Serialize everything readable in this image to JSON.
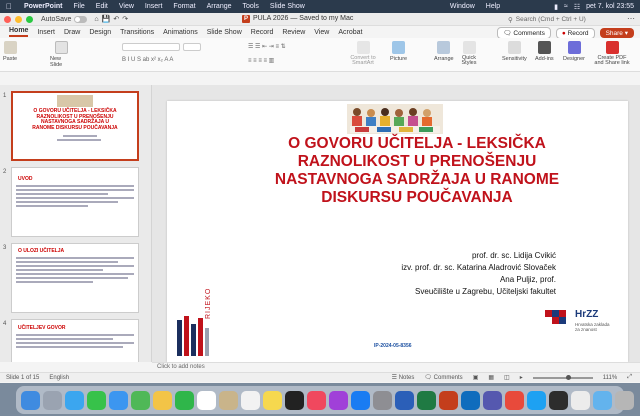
{
  "menubar": {
    "app_name": "PowerPoint",
    "items": [
      "File",
      "Edit",
      "View",
      "Insert",
      "Format",
      "Arrange",
      "Tools",
      "Slide Show",
      "Window",
      "Help"
    ],
    "clock": "pet 7. kol 23:55"
  },
  "titlebar": {
    "autosave_label": "AutoSave",
    "doc_title": "PULA 2026 — Saved to my Mac",
    "search_placeholder": "Search (Cmd + Ctrl + U)"
  },
  "tabs": {
    "items": [
      "Home",
      "Insert",
      "Draw",
      "Design",
      "Transitions",
      "Animations",
      "Slide Show",
      "Record",
      "Review",
      "View",
      "Acrobat"
    ],
    "comments_label": "Comments",
    "record_label": "Record",
    "share_label": "Share"
  },
  "ribbon": {
    "paste": "Paste",
    "new_slide": "New Slide",
    "convert": "Convert to SmartArt",
    "picture": "Picture",
    "arrange": "Arrange",
    "quick_styles": "Quick Styles",
    "sensitivity": "Sensitivity",
    "addins": "Add-ins",
    "designer": "Designer",
    "create_pdf": "Create PDF and Share link"
  },
  "thumbs": [
    {
      "num": "1",
      "title": "O GOVORU UČITELJA - LEKSIČKA RAZNOLIKOST U PRENOŠENJU NASTAVNOGA SADRŽAJA U RANOME DISKURSU POUČAVANJA"
    },
    {
      "num": "2",
      "title": "UVOD"
    },
    {
      "num": "3",
      "title": "O ULOZI UČITELJA"
    },
    {
      "num": "4",
      "title": "UČITELJEV GOVOR"
    }
  ],
  "slide": {
    "title": "O GOVORU UČITELJA - LEKSIČKA RAZNOLIKOST U PRENOŠENJU NASTAVNOGA SADRŽAJA U RANOME DISKURSU POUČAVANJA",
    "authors": [
      "prof. dr. sc. Lidija Cvikić",
      "izv. prof. dr. sc. Katarina Aladrović Slovaček",
      "Ana Puljiz, prof.",
      "Sveučilište u Zagrebu, Učiteljski fakultet"
    ],
    "project_id": "IP-2024-05-8356",
    "logo_left": "RIJEKO",
    "logo_right": "HrZZ",
    "logo_right_sub": "Hrvatska zaklada za znanost"
  },
  "notes_placeholder": "Click to add notes",
  "status": {
    "slide_of": "Slide 1 of 15",
    "language": "English",
    "notes": "Notes",
    "comments": "Comments",
    "zoom": "111%"
  },
  "colors": {
    "accent": "#c43e1c",
    "title_red": "#c0121b"
  }
}
